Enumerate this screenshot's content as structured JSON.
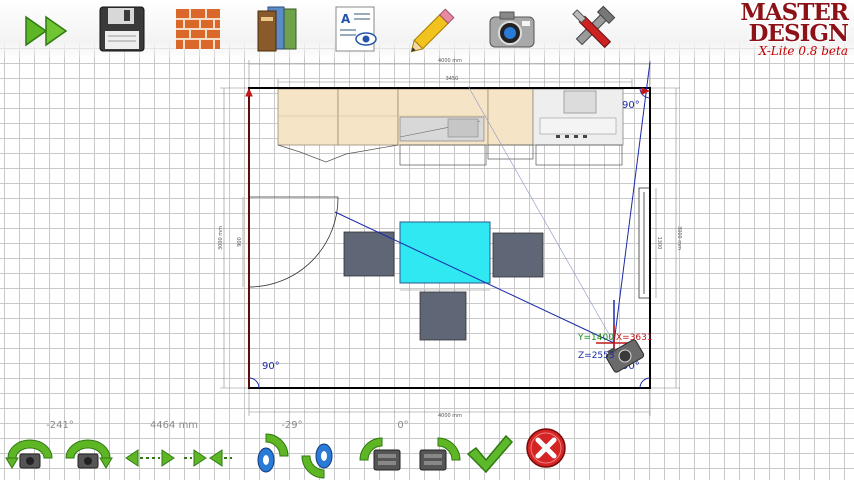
{
  "toolbar": {
    "buttons": [
      {
        "id": "play",
        "icon": "fast-forward-icon"
      },
      {
        "id": "save",
        "icon": "floppy-disk-icon"
      },
      {
        "id": "walls",
        "icon": "brick-wall-icon"
      },
      {
        "id": "catalog",
        "icon": "books-icon"
      },
      {
        "id": "view",
        "icon": "view-document-icon"
      },
      {
        "id": "edit",
        "icon": "pencil-icon"
      },
      {
        "id": "camera",
        "icon": "camera-icon"
      },
      {
        "id": "tools",
        "icon": "tools-icon"
      }
    ]
  },
  "logo": {
    "line1": "MASTER",
    "line2": "DESIGN",
    "version": "X-Lite 0.8 beta"
  },
  "plan": {
    "dim_top_outer": "4000 mm",
    "dim_top_inner": "3450",
    "dim_left_outer": "3000 mm",
    "dim_left_inner": "900",
    "dim_right_outer": "3000 mm",
    "dim_right_inner": "1300",
    "dim_bottom": "4000 mm",
    "dim_table": "900",
    "angle_top_right": "90°",
    "angle_bottom_left": "90°",
    "angle_bottom_right": "90°",
    "camera_y": "Y=1400",
    "camera_x": "X=3631",
    "camera_z": "Z=2553"
  },
  "bottom": {
    "rotate_angle": "-241°",
    "distance": "4464 mm",
    "tilt_angle": "-29°",
    "roll_angle": "0°",
    "buttons": [
      {
        "id": "rotate-left",
        "icon": "camera-rotate-left-icon"
      },
      {
        "id": "rotate-right",
        "icon": "camera-rotate-right-icon"
      },
      {
        "id": "move-away",
        "icon": "arrows-apart-icon"
      },
      {
        "id": "move-closer",
        "icon": "arrows-together-icon"
      },
      {
        "id": "tilt-up",
        "icon": "camera-tilt-up-icon"
      },
      {
        "id": "tilt-down",
        "icon": "camera-tilt-down-icon"
      },
      {
        "id": "roll-left",
        "icon": "camera-roll-left-icon"
      },
      {
        "id": "roll-right",
        "icon": "camera-roll-right-icon"
      },
      {
        "id": "confirm",
        "icon": "checkmark-icon"
      },
      {
        "id": "cancel",
        "icon": "close-icon"
      }
    ]
  },
  "colors": {
    "logo_red": "#8c1218",
    "table_cyan": "#30e8f2",
    "chair_gray": "#5f6676",
    "cabinet_beige": "#f6e4c6",
    "camera_line_blue": "#1a2aaa",
    "wall_black": "#000000",
    "cancel_red": "#d42424",
    "confirm_green": "#5db82a"
  }
}
